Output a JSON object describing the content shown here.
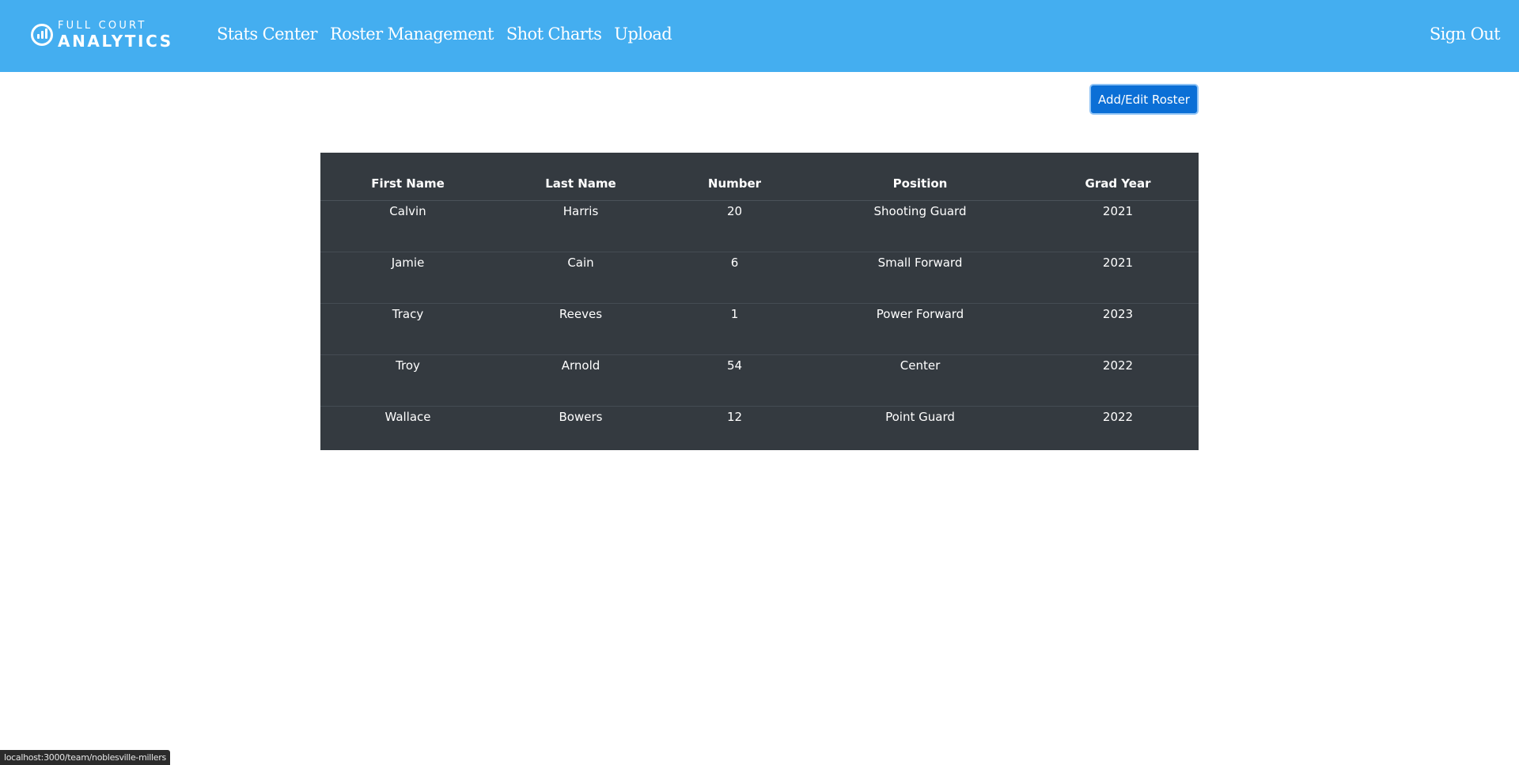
{
  "brand": {
    "line1": "FULL COURT",
    "line2": "ANALYTICS"
  },
  "nav": {
    "links": [
      "Stats Center",
      "Roster Management",
      "Shot Charts",
      "Upload"
    ],
    "sign_out": "Sign Out"
  },
  "toolbar": {
    "add_edit_label": "Add/Edit Roster"
  },
  "roster": {
    "headers": [
      "First Name",
      "Last Name",
      "Number",
      "Position",
      "Grad Year"
    ],
    "rows": [
      [
        "Calvin",
        "Harris",
        "20",
        "Shooting Guard",
        "2021"
      ],
      [
        "Jamie",
        "Cain",
        "6",
        "Small Forward",
        "2021"
      ],
      [
        "Tracy",
        "Reeves",
        "1",
        "Power Forward",
        "2023"
      ],
      [
        "Troy",
        "Arnold",
        "54",
        "Center",
        "2022"
      ],
      [
        "Wallace",
        "Bowers",
        "12",
        "Point Guard",
        "2022"
      ]
    ]
  },
  "status_bar": {
    "url": "localhost:3000/team/noblesville-millers"
  },
  "colors": {
    "navbar": "#44aef0",
    "button": "#0b6fd6",
    "table_bg": "#343a40"
  }
}
